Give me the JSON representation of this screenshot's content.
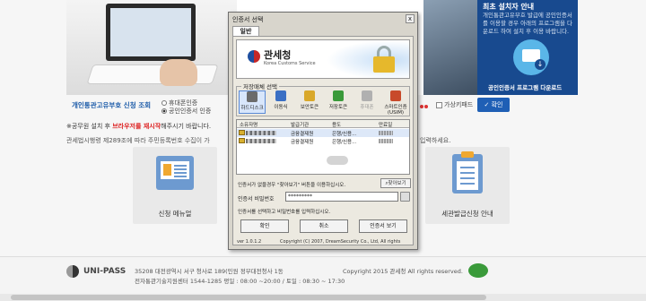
{
  "background": {
    "hero_title": "최초 설치자 안내",
    "hero_desc": "개인통관고유부호 발급에 공인인증서를 이용할 경우 아래의 프로그램을 다운로드 하여 설치 후 이용 바랍니다.",
    "download_label": "공인인증서 프로그램 다운로드",
    "personal_title": "개인통관고유부호 신청 조회",
    "radio_1": "휴대폰인증",
    "radio_2": "공인인증서 인증",
    "virtual_keyboard": "가상키패드",
    "confirm": "확인",
    "notice_prefix": "※공무원 설치 후 ",
    "notice_red": "브라우저를 재시작",
    "notice_suffix": "해주시기 바랍니다.",
    "law_text": "관세법시행령 제289조에 따라 주민등록번호 수집이 가",
    "law_tail": "입력하세요.",
    "card_manual": "신청 메뉴얼",
    "card_customs": "세관발급신청 안내",
    "footer_brand": "UNI-PASS",
    "footer_addr1": "35208 대전광역시 서구 청사로 189(민원 정부대전청사 1동",
    "footer_addr2": "전자통관기술지원센터 1544-1285 평일 : 08:00 ~20:00 / 토일 : 08:30 ~ 17:30",
    "footer_copy": "Copyright 2015 관세청 All rights reserved."
  },
  "dialog": {
    "title": "인증서 선택",
    "close": "x",
    "tab": "일반",
    "banner_name": "관세청",
    "banner_en": "Korea Customs Service",
    "storage_label": "저장매체 선택",
    "storage_items": [
      {
        "label": "하드디스크",
        "color": "#6b6b6b"
      },
      {
        "label": "이동식",
        "color": "#3a6fc4"
      },
      {
        "label": "보안토큰",
        "color": "#d9a82a"
      },
      {
        "label": "저장토큰",
        "color": "#3a9a3a"
      },
      {
        "label": "휴대폰",
        "color": "#b0b0b0"
      },
      {
        "label": "스마트인증",
        "color": "#c84a2a"
      }
    ],
    "storage_sub": "(USIM)",
    "columns": {
      "owner": "소유자명",
      "issuer": "발급기관",
      "usage": "용도",
      "expiry": "만료일"
    },
    "rows": [
      {
        "issuer": "금융결제원",
        "usage": "은행/신용..."
      },
      {
        "issuer": "금융결제원",
        "usage": "은행/신용..."
      }
    ],
    "hint_notice": "인증서가 없을경우 \"찾아보기\" 버튼을 이용하십시오.",
    "find_button": "찾아보기",
    "password_label": "인증서 비밀번호",
    "password_value": "*********",
    "password_hint": "인증서를 선택하고 비밀번호를 입력하십시오.",
    "ok": "확인",
    "cancel": "취소",
    "view": "인증서 보기",
    "version": "ver 1.0.1.2",
    "copyright": "Copyright (C) 2007, DreamSecurity Co., Ltd, All rights"
  }
}
